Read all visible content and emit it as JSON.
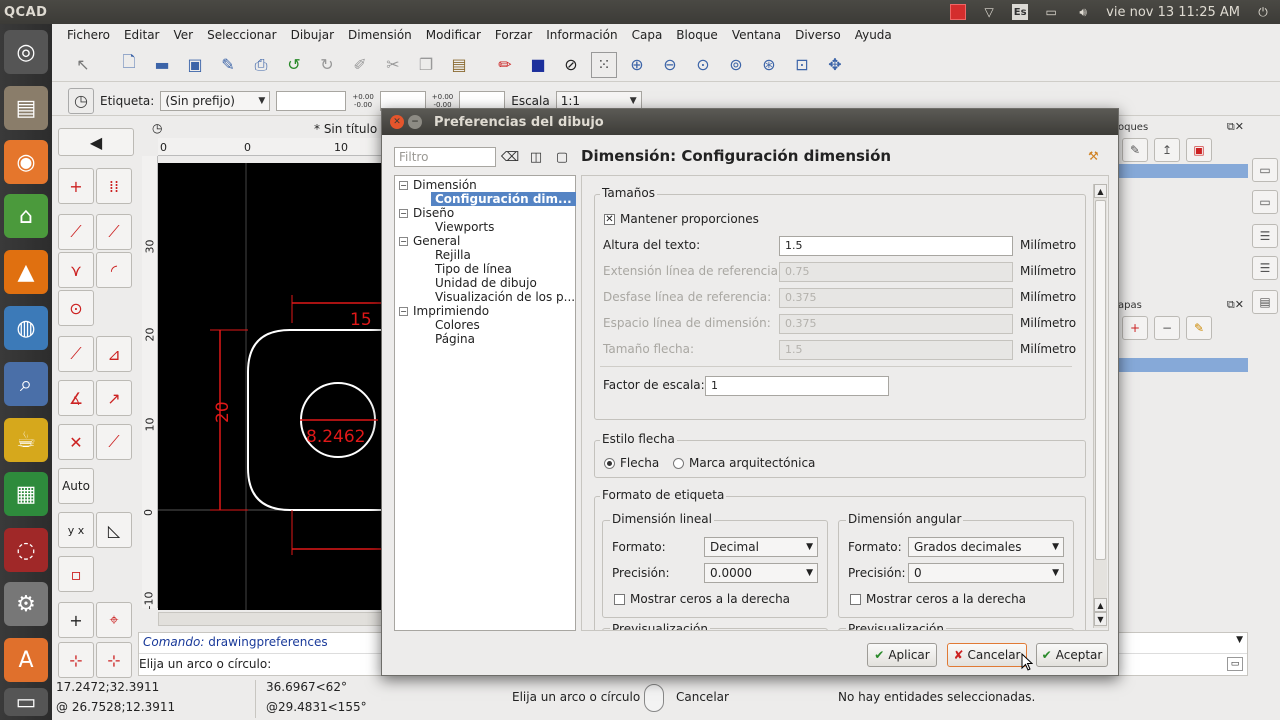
{
  "topbar": {
    "app_title": "QCAD",
    "clock": "vie nov 13 11:25 AM",
    "lang": "Es"
  },
  "menu": [
    "Fichero",
    "Editar",
    "Ver",
    "Seleccionar",
    "Dibujar",
    "Dimensión",
    "Modificar",
    "Forzar",
    "Información",
    "Capa",
    "Bloque",
    "Ventana",
    "Diverso",
    "Ayuda"
  ],
  "toolbar2": {
    "label_etiqueta": "Etiqueta:",
    "etiqueta_value": "(Sin prefijo)",
    "tol1_top": "+0.00",
    "tol1_bottom": "-0.00",
    "tol2_top": "+0.00",
    "tol2_bottom": "-0.00",
    "label_escala": "Escala",
    "escala_value": "1:1"
  },
  "document": {
    "tab_title": "* Sin título",
    "ruler_top": [
      "0",
      "0",
      "10"
    ],
    "ruler_left": [
      "30",
      "20",
      "10",
      "0",
      "-10"
    ]
  },
  "palette": {
    "auto_label": "Auto"
  },
  "drawing": {
    "dim_15": "15",
    "dim_20": "20",
    "dim_diameter": "8.2462"
  },
  "command": {
    "prompt_label": "Comando:",
    "prompt_value": "drawingpreferences",
    "hint": "Elija un arco o círculo:"
  },
  "status": {
    "coord_abs": "17.2472;32.3911",
    "coord_rel": "@ 26.7528;12.3911",
    "polar_abs": "36.6967<62°",
    "polar_rel": "@29.4831<155°",
    "left_mouse": "Elija un arco o círculo",
    "right_mouse": "Cancelar",
    "selection": "No hay entidades seleccionadas."
  },
  "dock": {
    "bloques_title": "oques",
    "capas_title": "apas"
  },
  "dialog": {
    "title": "Preferencias del dibujo",
    "filter_placeholder": "Filtro",
    "heading": "Dimensión: Configuración dimensión",
    "tree": [
      {
        "label": "Dimensión",
        "level": 0,
        "expander": "−"
      },
      {
        "label": "Configuración dim...",
        "level": 1,
        "selected": true
      },
      {
        "label": "Diseño",
        "level": 0,
        "expander": "−"
      },
      {
        "label": "Viewports",
        "level": 1
      },
      {
        "label": "General",
        "level": 0,
        "expander": "−"
      },
      {
        "label": "Rejilla",
        "level": 1
      },
      {
        "label": "Tipo de línea",
        "level": 1
      },
      {
        "label": "Unidad de dibujo",
        "level": 1
      },
      {
        "label": "Visualización de los p...",
        "level": 1
      },
      {
        "label": "Imprimiendo",
        "level": 0,
        "expander": "−"
      },
      {
        "label": "Colores",
        "level": 1
      },
      {
        "label": "Página",
        "level": 1
      }
    ],
    "sizes": {
      "title": "Tamaños",
      "keep_proportions": "Mantener proporciones",
      "rows": [
        {
          "label": "Altura del texto:",
          "value": "1.5",
          "unit": "Milímetro",
          "enabled": true
        },
        {
          "label": "Extensión línea de referencia:",
          "value": "0.75",
          "unit": "Milímetro",
          "enabled": false
        },
        {
          "label": "Desfase línea de referencia:",
          "value": "0.375",
          "unit": "Milímetro",
          "enabled": false
        },
        {
          "label": "Espacio línea de dimensión:",
          "value": "0.375",
          "unit": "Milímetro",
          "enabled": false
        },
        {
          "label": "Tamaño flecha:",
          "value": "1.5",
          "unit": "Milímetro",
          "enabled": false
        }
      ],
      "scale_label": "Factor de escala:",
      "scale_value": "1"
    },
    "arrow_style": {
      "title": "Estilo flecha",
      "option1": "Flecha",
      "option2": "Marca arquitectónica"
    },
    "label_format": {
      "title": "Formato de etiqueta",
      "linear": {
        "title": "Dimensión lineal",
        "format_label": "Formato:",
        "format_value": "Decimal",
        "precision_label": "Precisión:",
        "precision_value": "0.0000",
        "trailing_zeros": "Mostrar ceros a la derecha"
      },
      "angular": {
        "title": "Dimensión angular",
        "format_label": "Formato:",
        "format_value": "Grados decimales",
        "precision_label": "Precisión:",
        "precision_value": "0",
        "trailing_zeros": "Mostrar ceros a la derecha"
      },
      "preview1": "Previsualización",
      "preview2": "Previsualización"
    },
    "buttons": {
      "apply": "Aplicar",
      "cancel": "Cancelar",
      "accept": "Aceptar"
    }
  },
  "colors": {
    "accent": "#e5552c",
    "selection": "#5584c4",
    "drawing_red": "#e01818"
  }
}
